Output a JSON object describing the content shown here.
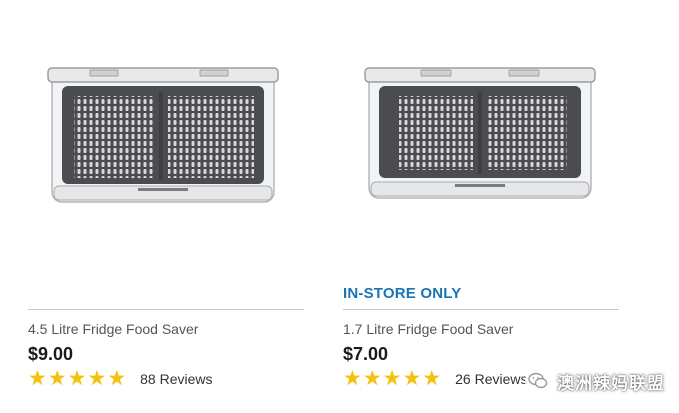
{
  "products": [
    {
      "badge": "",
      "title": "4.5 Litre Fridge Food Saver",
      "price": "$9.00",
      "rating_stars": 5,
      "reviews": "88 Reviews",
      "image_icon": "food-saver-container"
    },
    {
      "badge": "IN-STORE ONLY",
      "title": "1.7 Litre Fridge Food Saver",
      "price": "$7.00",
      "rating_stars": 5,
      "reviews": "26 Reviews",
      "image_icon": "food-saver-container"
    }
  ],
  "watermark": {
    "text": "澳洲辣妈联盟",
    "icon": "wechat-icon"
  },
  "colors": {
    "badge": "#1a73b5",
    "star": "#f4c20d",
    "basket": "#4a4c52",
    "divider": "#c8c8c8"
  }
}
